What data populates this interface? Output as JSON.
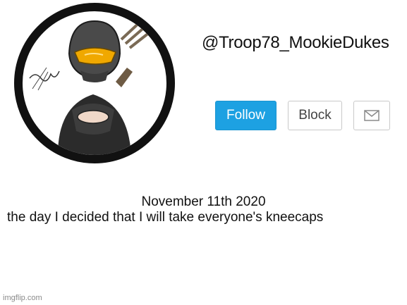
{
  "profile": {
    "handle": "@Troop78_MookieDukes",
    "avatar_icon": "armored-soldier-avatar-icon"
  },
  "actions": {
    "follow_label": "Follow",
    "block_label": "Block",
    "message_icon": "envelope-icon"
  },
  "post": {
    "line1": "November 11th 2020",
    "line2": "the day I decided that I will take everyone's kneecaps"
  },
  "watermark": "imgflip.com",
  "colors": {
    "follow_bg": "#1da1e2",
    "ring": "#111111"
  }
}
